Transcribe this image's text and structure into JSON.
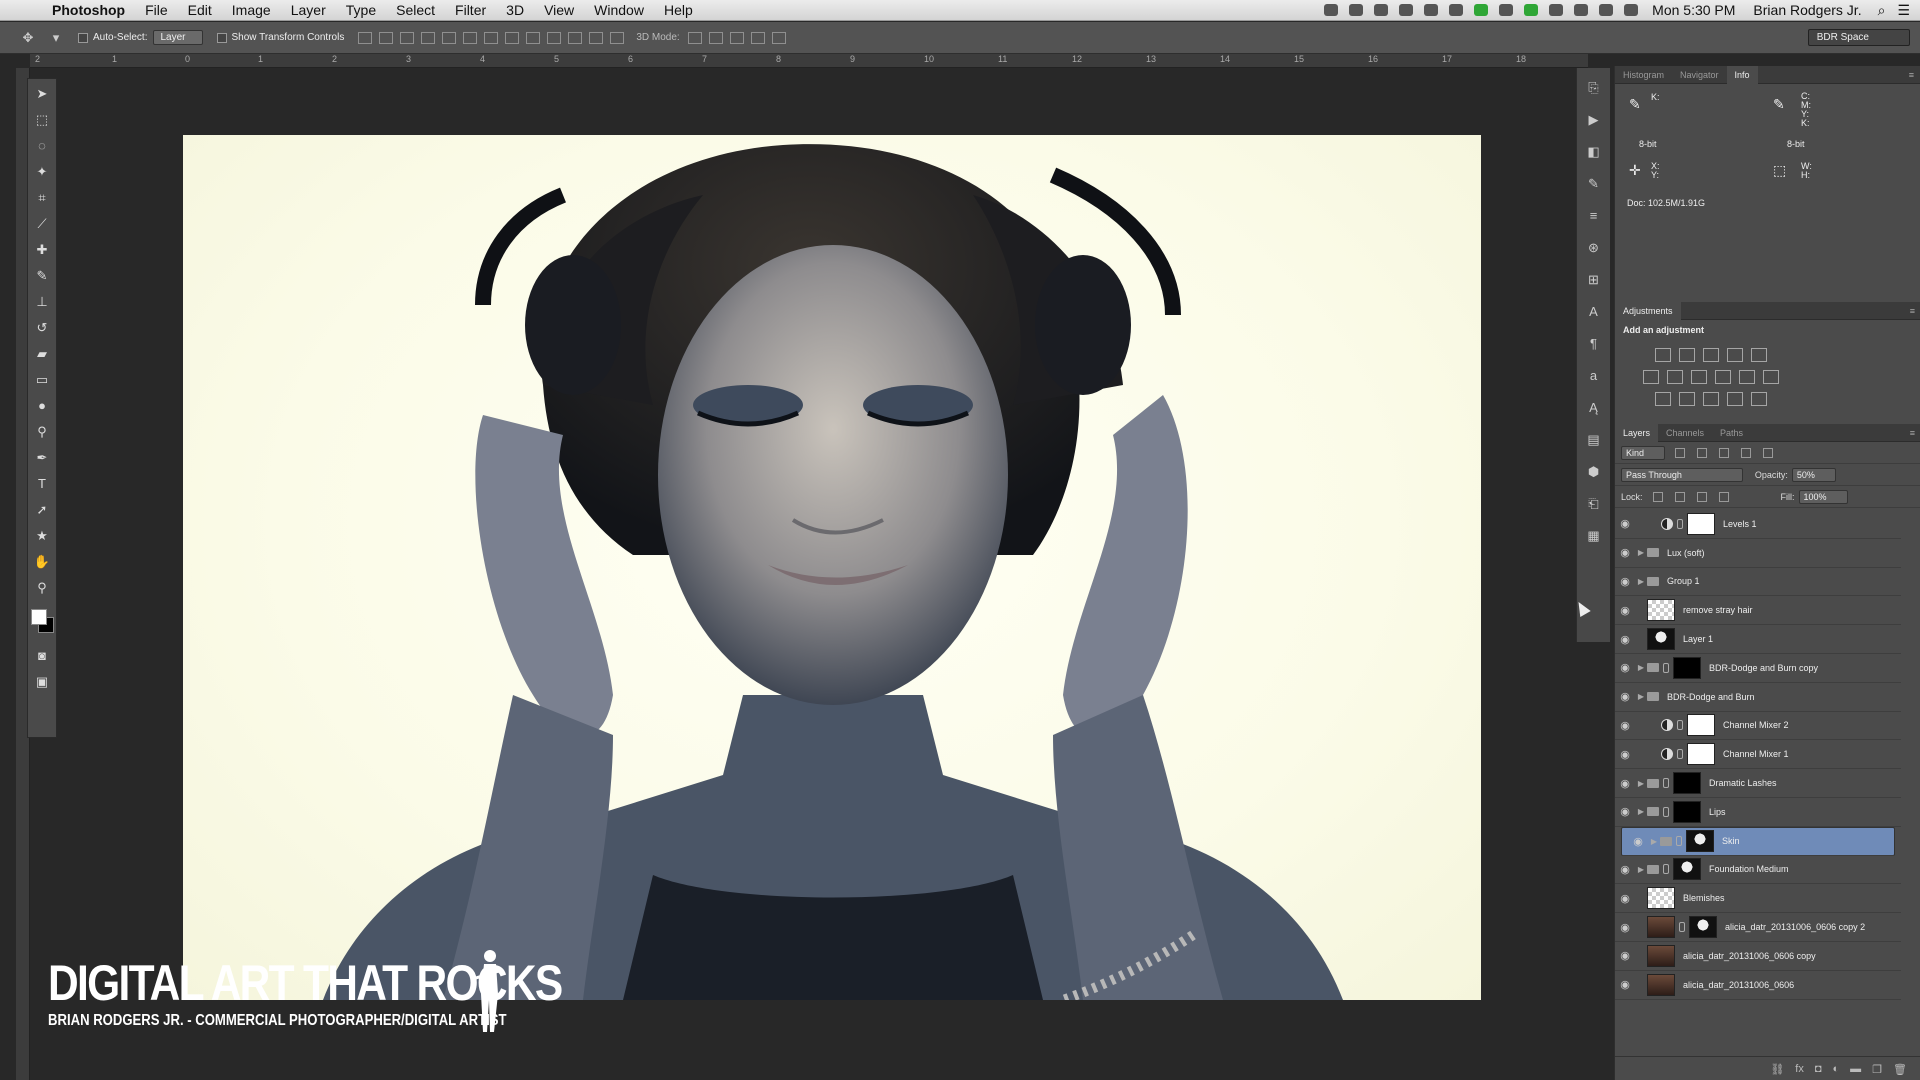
{
  "menubar": {
    "apple": "",
    "app": "Photoshop",
    "items": [
      "File",
      "Edit",
      "Image",
      "Layer",
      "Type",
      "Select",
      "Filter",
      "3D",
      "View",
      "Window",
      "Help"
    ],
    "clock": "Mon 5:30 PM",
    "user": "Brian Rodgers Jr."
  },
  "options": {
    "auto_select_label": "Auto-Select:",
    "auto_select_value": "Layer",
    "transform_label": "Show Transform Controls",
    "mode3d_label": "3D Mode:",
    "workspace": "BDR Space"
  },
  "ruler": {
    "ticks": [
      "2",
      "1",
      "0",
      "1",
      "2",
      "3",
      "4",
      "5",
      "6",
      "7",
      "8",
      "9",
      "10",
      "11",
      "12",
      "13",
      "14",
      "15",
      "16",
      "17",
      "18"
    ]
  },
  "watermark": {
    "title": "DIGITAL ART THAT ROCKS",
    "subtitle": "BRIAN RODGERS JR. - COMMERCIAL PHOTOGRAPHER/DIGITAL ARTIST"
  },
  "info_panel": {
    "tabs": [
      "Histogram",
      "Navigator",
      "Info"
    ],
    "k": "K:",
    "cmyk": "C:\nM:\nY:\nK:",
    "bit1": "8-bit",
    "bit2": "8-bit",
    "xy": "X:\nY:",
    "wh": "W:\nH:",
    "doc": "Doc: 102.5M/1.91G"
  },
  "adjustments": {
    "title": "Adjustments",
    "subtitle": "Add an adjustment"
  },
  "layers_panel": {
    "tabs": [
      "Layers",
      "Channels",
      "Paths"
    ],
    "filter_kind": "Kind",
    "blend_mode": "Pass Through",
    "opacity_label": "Opacity:",
    "opacity_value": "50%",
    "lock_label": "Lock:",
    "fill_label": "Fill:",
    "fill_value": "100%",
    "layers": [
      {
        "name": "Levels 1",
        "kind": "adj",
        "thumb": "w"
      },
      {
        "name": "Lux (soft)",
        "kind": "group"
      },
      {
        "name": "Group 1",
        "kind": "group"
      },
      {
        "name": "remove stray hair",
        "kind": "pixel",
        "thumb": "t"
      },
      {
        "name": "Layer 1",
        "kind": "pixel",
        "thumb": "ph"
      },
      {
        "name": "BDR-Dodge and Burn copy",
        "kind": "groupmask",
        "thumb": "k"
      },
      {
        "name": "BDR-Dodge and Burn",
        "kind": "group"
      },
      {
        "name": "Channel Mixer 2",
        "kind": "adj",
        "thumb": "w"
      },
      {
        "name": "Channel Mixer 1",
        "kind": "adj",
        "thumb": "w"
      },
      {
        "name": "Dramatic Lashes",
        "kind": "groupmask",
        "thumb": "k"
      },
      {
        "name": "Lips",
        "kind": "groupmask",
        "thumb": "k"
      },
      {
        "name": "Skin",
        "kind": "groupmask",
        "thumb": "ph",
        "selected": true
      },
      {
        "name": "Foundation Medium",
        "kind": "groupmask",
        "thumb": "ph"
      },
      {
        "name": "Blemishes",
        "kind": "pixel",
        "thumb": "t"
      },
      {
        "name": "alicia_datr_20131006_0606 copy 2",
        "kind": "pixelmask",
        "thumb": "p"
      },
      {
        "name": "alicia_datr_20131006_0606 copy",
        "kind": "pixel",
        "thumb": "p"
      },
      {
        "name": "alicia_datr_20131006_0606",
        "kind": "pixel",
        "thumb": "p"
      }
    ]
  }
}
